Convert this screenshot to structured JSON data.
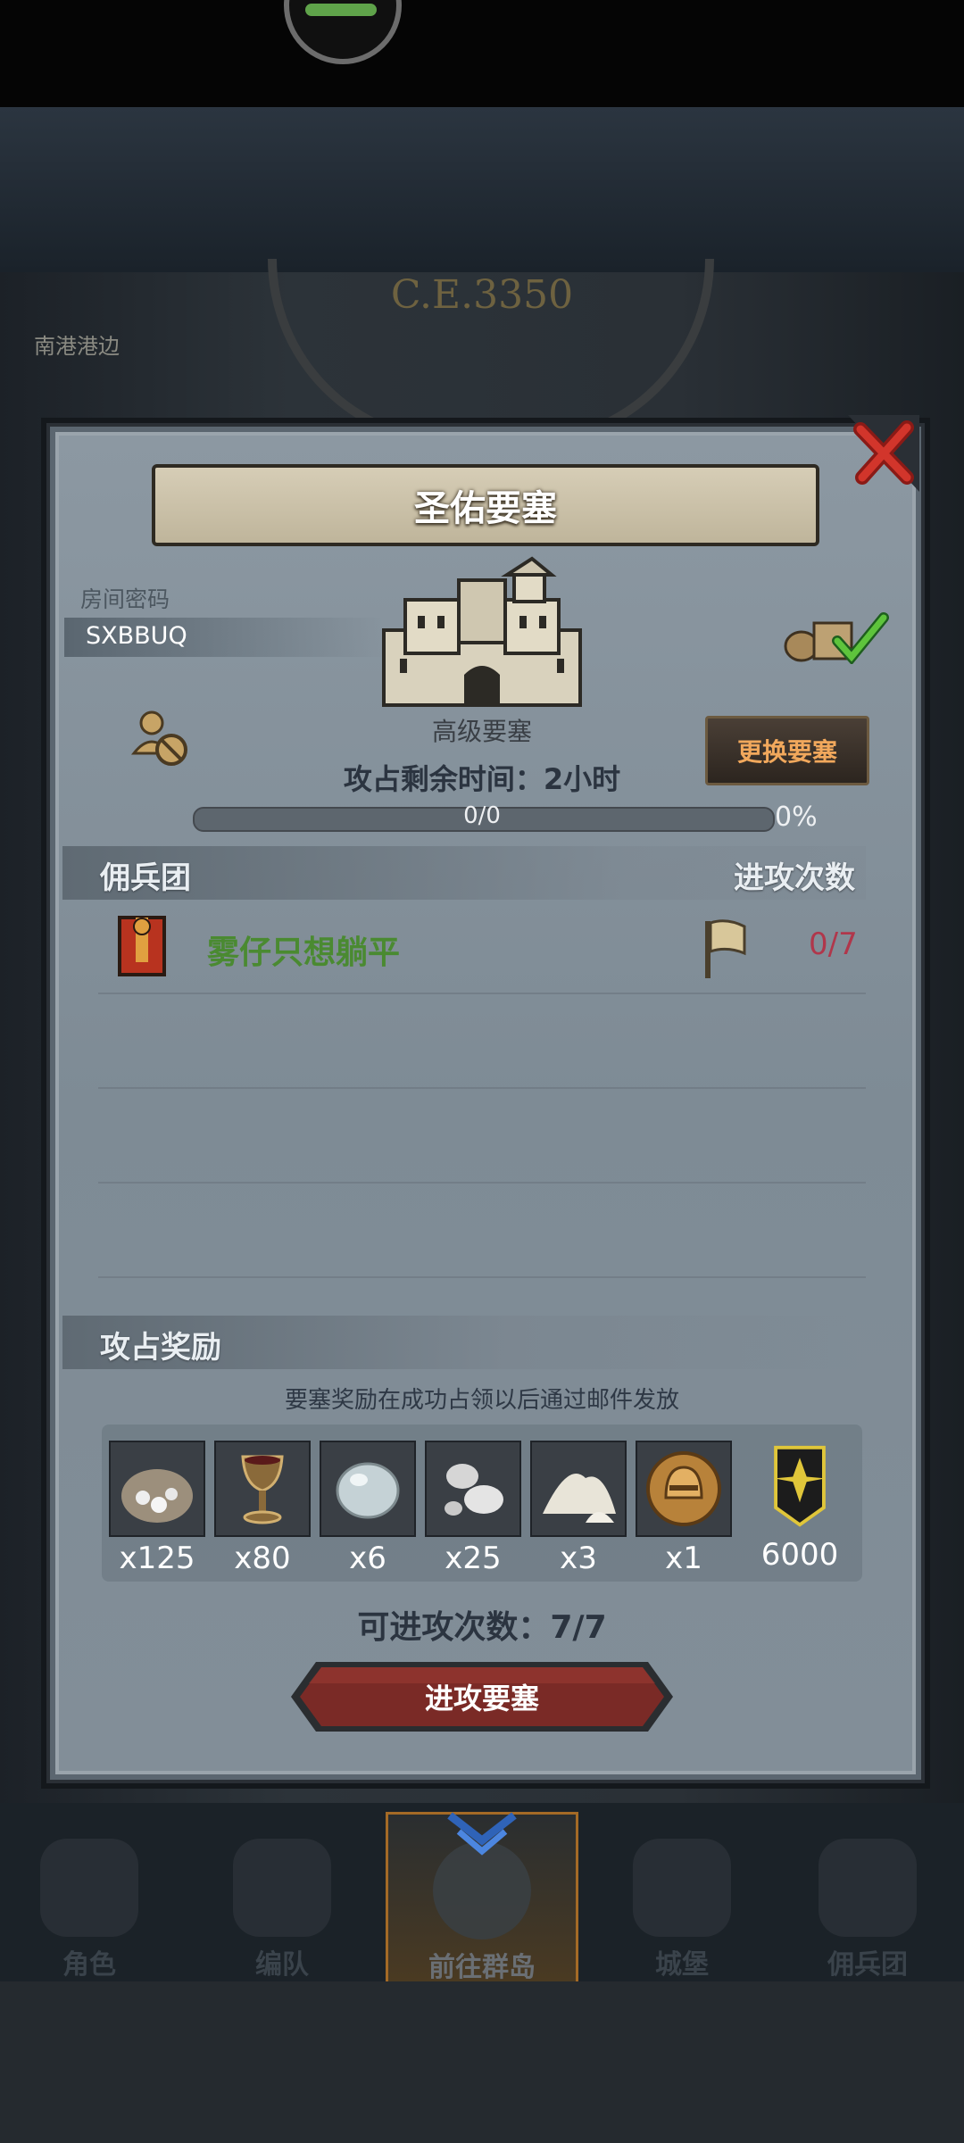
{
  "background": {
    "era": "C.E.3350",
    "town": "南港港边"
  },
  "panel": {
    "title": "圣佑要塞",
    "room_label": "房间密码",
    "room_code": "SXBBUQ",
    "fortress_type": "高级要塞",
    "change_button": "更换要塞",
    "time_left": "攻占剩余时间：2小时",
    "progress_text": "0/0",
    "progress_value": 0,
    "progress_percent": "0%"
  },
  "guild_section": {
    "label": "佣兵团",
    "attack_header": "进攻次数",
    "rows": [
      {
        "name": "雾仔只想躺平",
        "attacks": "0/7"
      }
    ]
  },
  "reward_section": {
    "label": "攻占奖励",
    "note": "要塞奖励在成功占领以后通过邮件发放",
    "items": [
      {
        "icon": "ore-sack-icon",
        "qty": "x125"
      },
      {
        "icon": "chalice-icon",
        "qty": "x80"
      },
      {
        "icon": "stone-icon",
        "qty": "x6"
      },
      {
        "icon": "pearls-icon",
        "qty": "x25"
      },
      {
        "icon": "powder-icon",
        "qty": "x3"
      },
      {
        "icon": "helmet-coin-icon",
        "qty": "x1"
      },
      {
        "icon": "rank-badge-icon",
        "qty": "6000"
      }
    ],
    "attempts": "可进攻次数：7/7",
    "attack_button": "进攻要塞"
  },
  "nav": {
    "items": [
      {
        "label": "角色"
      },
      {
        "label": "编队"
      },
      {
        "label": "前往群岛"
      },
      {
        "label": "城堡"
      },
      {
        "label": "佣兵团"
      }
    ],
    "active_index": 2
  },
  "colors": {
    "guild_name": "#4a8a31",
    "attack_count": "#b0374b",
    "change_button_text": "#f1a85c"
  }
}
